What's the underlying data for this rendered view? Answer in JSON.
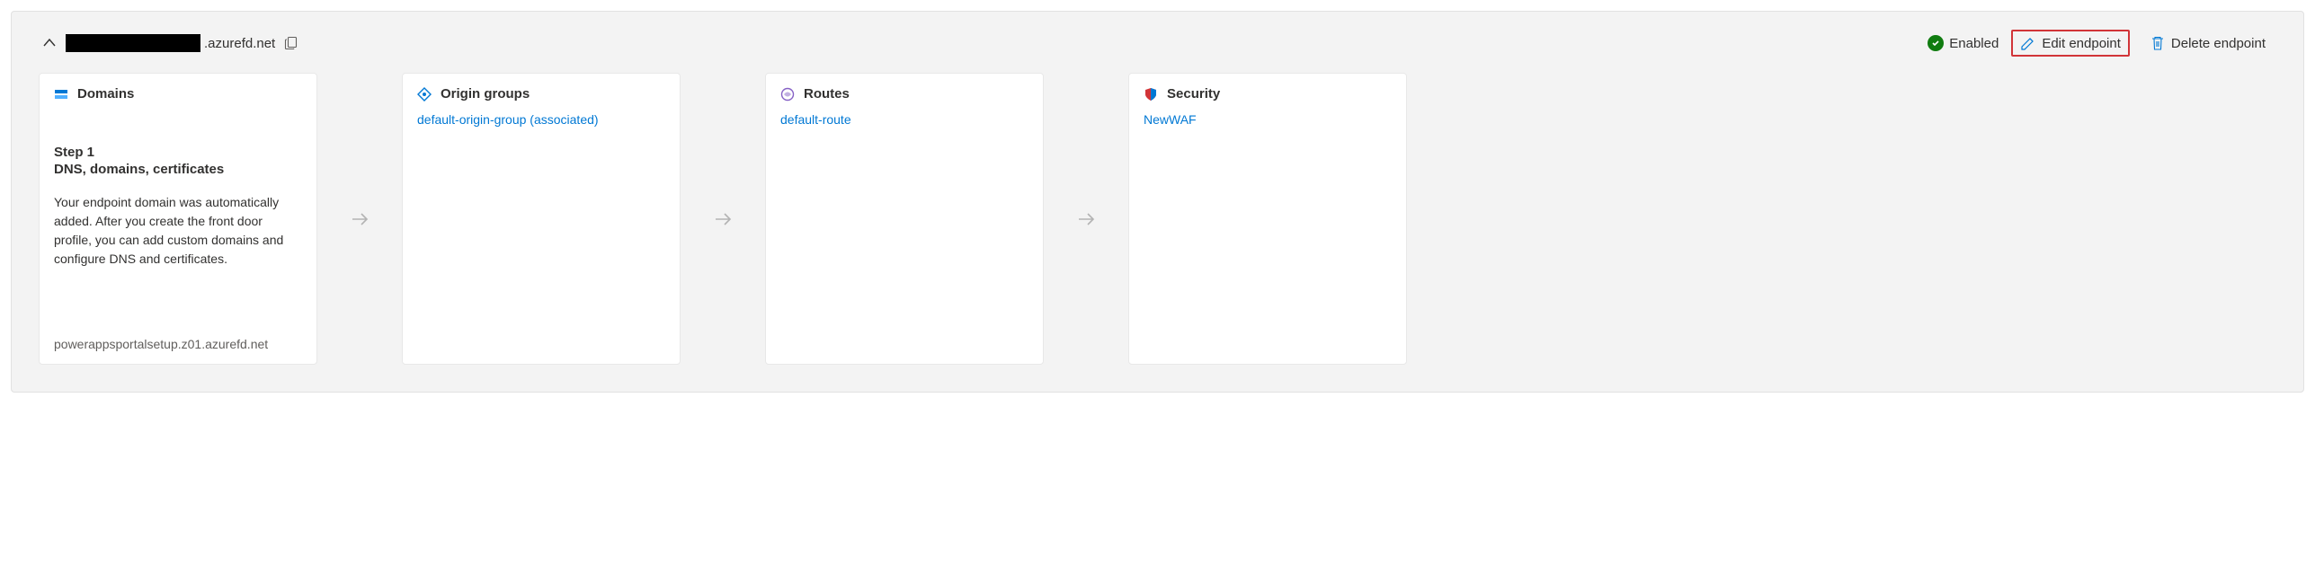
{
  "header": {
    "domain_suffix": ".azurefd.net",
    "status_label": "Enabled",
    "edit_label": "Edit endpoint",
    "delete_label": "Delete endpoint"
  },
  "cards": {
    "domains": {
      "title": "Domains",
      "step_num": "Step 1",
      "step_title": "DNS, domains, certificates",
      "step_desc": "Your endpoint domain was automatically added. After you create the front door profile, you can add custom domains and configure DNS and certificates.",
      "footer": "powerappsportalsetup.z01.azurefd.net"
    },
    "origin_groups": {
      "title": "Origin groups",
      "item": "default-origin-group (associated)"
    },
    "routes": {
      "title": "Routes",
      "item": "default-route"
    },
    "security": {
      "title": "Security",
      "item": "NewWAF"
    }
  }
}
